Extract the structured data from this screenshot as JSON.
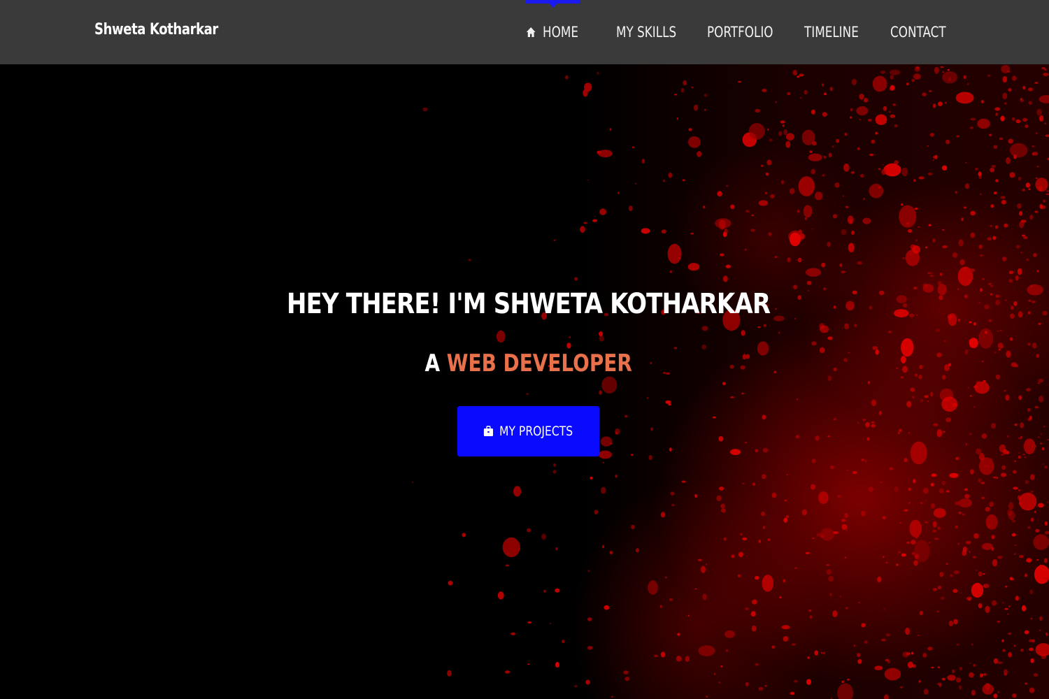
{
  "navbar": {
    "brand": "Shweta Kotharkar",
    "items": [
      {
        "label": "HOME",
        "icon": "home-icon",
        "active": true
      },
      {
        "label": "MY SKILLS"
      },
      {
        "label": "PORTFOLIO"
      },
      {
        "label": "TIMELINE"
      },
      {
        "label": "CONTACT"
      }
    ],
    "active_indicator_color": "#1a1af0"
  },
  "hero": {
    "headline": "HEY THERE! I'M SHWETA KOTHARKAR",
    "sub_prefix": "A ",
    "sub_accent": "WEB DEVELOPER",
    "accent_color": "#e8704a",
    "cta_label": "MY PROJECTS",
    "cta_icon": "briefcase-icon",
    "cta_color": "#0a0aff",
    "background": "black with red paint splatter"
  }
}
